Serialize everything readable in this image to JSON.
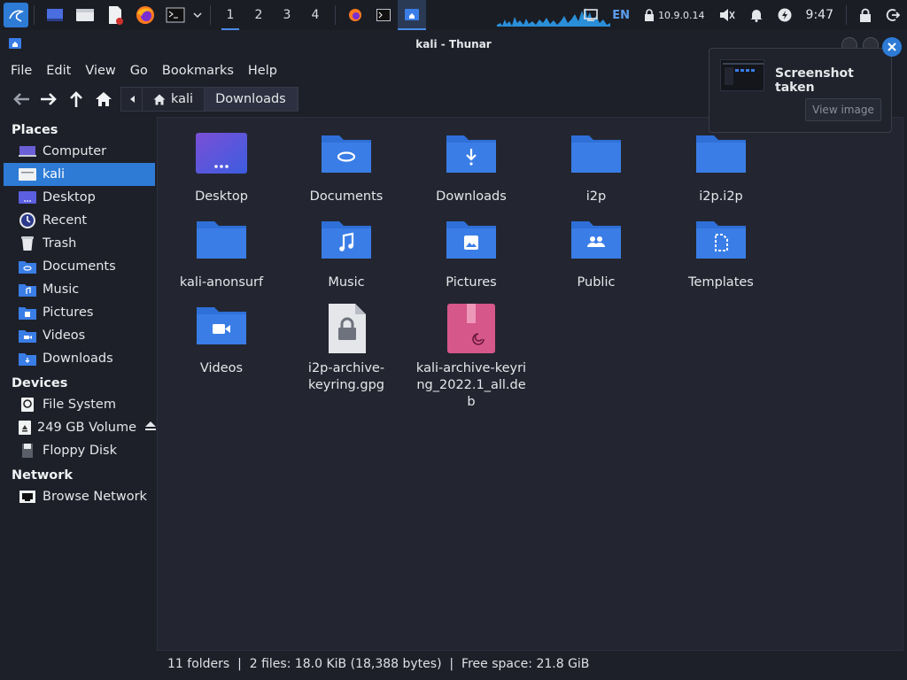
{
  "panel": {
    "workspaces": [
      "1",
      "2",
      "3",
      "4"
    ],
    "lang": "EN",
    "ip": "10.9.0.14",
    "clock": "9:47"
  },
  "window": {
    "title": "kali - Thunar"
  },
  "menu": [
    "File",
    "Edit",
    "View",
    "Go",
    "Bookmarks",
    "Help"
  ],
  "pathbar": {
    "home_label": "kali",
    "current_label": "Downloads"
  },
  "sidebar": {
    "places_title": "Places",
    "places": [
      "Computer",
      "kali",
      "Desktop",
      "Recent",
      "Trash",
      "Documents",
      "Music",
      "Pictures",
      "Videos",
      "Downloads"
    ],
    "devices_title": "Devices",
    "devices": [
      "File System",
      "249 GB Volume",
      "Floppy Disk"
    ],
    "network_title": "Network",
    "network": [
      "Browse Network"
    ]
  },
  "files": [
    {
      "name": "Desktop",
      "icon": "desktop-folder-icon"
    },
    {
      "name": "Documents",
      "icon": "documents-folder-icon"
    },
    {
      "name": "Downloads",
      "icon": "downloads-folder-icon"
    },
    {
      "name": "i2p",
      "icon": "folder-icon"
    },
    {
      "name": "i2p.i2p",
      "icon": "folder-icon"
    },
    {
      "name": "kali-anonsurf",
      "icon": "folder-icon"
    },
    {
      "name": "Music",
      "icon": "music-folder-icon"
    },
    {
      "name": "Pictures",
      "icon": "pictures-folder-icon"
    },
    {
      "name": "Public",
      "icon": "public-folder-icon"
    },
    {
      "name": "Templates",
      "icon": "templates-folder-icon"
    },
    {
      "name": "Videos",
      "icon": "videos-folder-icon"
    },
    {
      "name": "i2p-archive-keyring.gpg",
      "icon": "gpg-file-icon"
    },
    {
      "name": "kali-archive-keyring_2022.1_all.deb",
      "icon": "deb-package-icon"
    }
  ],
  "status": "11 folders  |  2 files: 18.0 KiB (18,388 bytes)  |  Free space: 21.8 GiB",
  "notification": {
    "title": "Screenshot taken",
    "button": "View image"
  },
  "colors": {
    "accent": "#2e7bd6",
    "folder": "#3a7de6",
    "background": "#232631"
  }
}
